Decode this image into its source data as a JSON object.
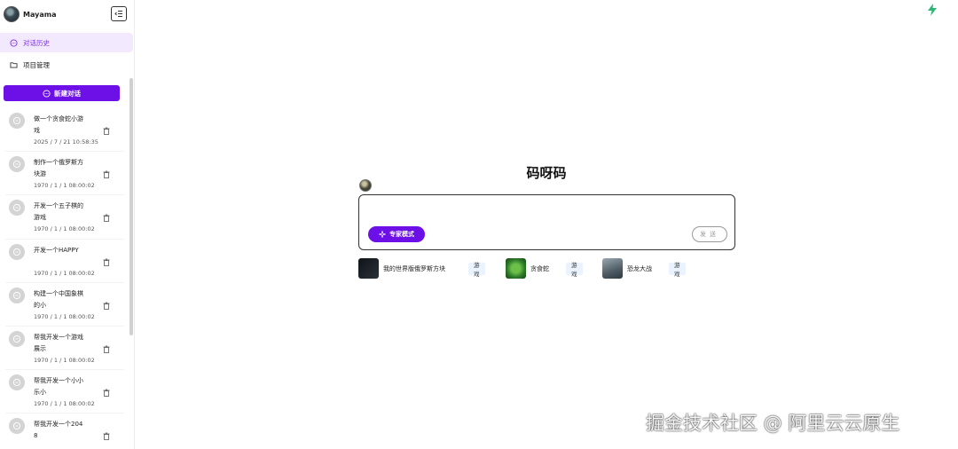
{
  "brand": {
    "name": "Mayama"
  },
  "nav": [
    {
      "label": "对话历史",
      "icon": "chat-bubble-icon",
      "active": true
    },
    {
      "label": "项目管理",
      "icon": "folder-icon",
      "active": false
    }
  ],
  "new_chat_label": "新建对话",
  "history": [
    {
      "title": "做一个贪食蛇小游戏",
      "time": "2025 / 7 / 21 10:58:35"
    },
    {
      "title": "制作一个俄罗斯方块游",
      "time": "1970 / 1 / 1 08:00:02"
    },
    {
      "title": "开发一个五子棋的游戏",
      "time": "1970 / 1 / 1 08:00:02"
    },
    {
      "title": "开发一个HAPPY",
      "time": "1970 / 1 / 1 08:00:02"
    },
    {
      "title": "构建一个中国象棋的小",
      "time": "1970 / 1 / 1 08:00:02"
    },
    {
      "title": "帮我开发一个游戏展示",
      "time": "1970 / 1 / 1 08:00:02"
    },
    {
      "title": "帮我开发一个小小乐小",
      "time": "1970 / 1 / 1 08:00:02"
    },
    {
      "title": "帮我开发一个2048",
      "time": ""
    }
  ],
  "main": {
    "title": "码呀码",
    "expert_mode_label": "专家模式",
    "send_label": "发送"
  },
  "suggestions": [
    {
      "label": "我的世界版俄罗斯方块",
      "tag": "游戏",
      "thumb_color": "#1a1f24"
    },
    {
      "label": "贪食蛇",
      "tag": "游戏",
      "thumb_color": "#2f7d2a"
    },
    {
      "label": "恐龙大战",
      "tag": "游戏",
      "thumb_color": "#6c7d88"
    }
  ],
  "watermark": "掘金技术社区 @ 阿里云云原生",
  "colors": {
    "accent": "#6d10e8",
    "active_bg": "#f3e9ff",
    "bolt": "#2bb673"
  }
}
